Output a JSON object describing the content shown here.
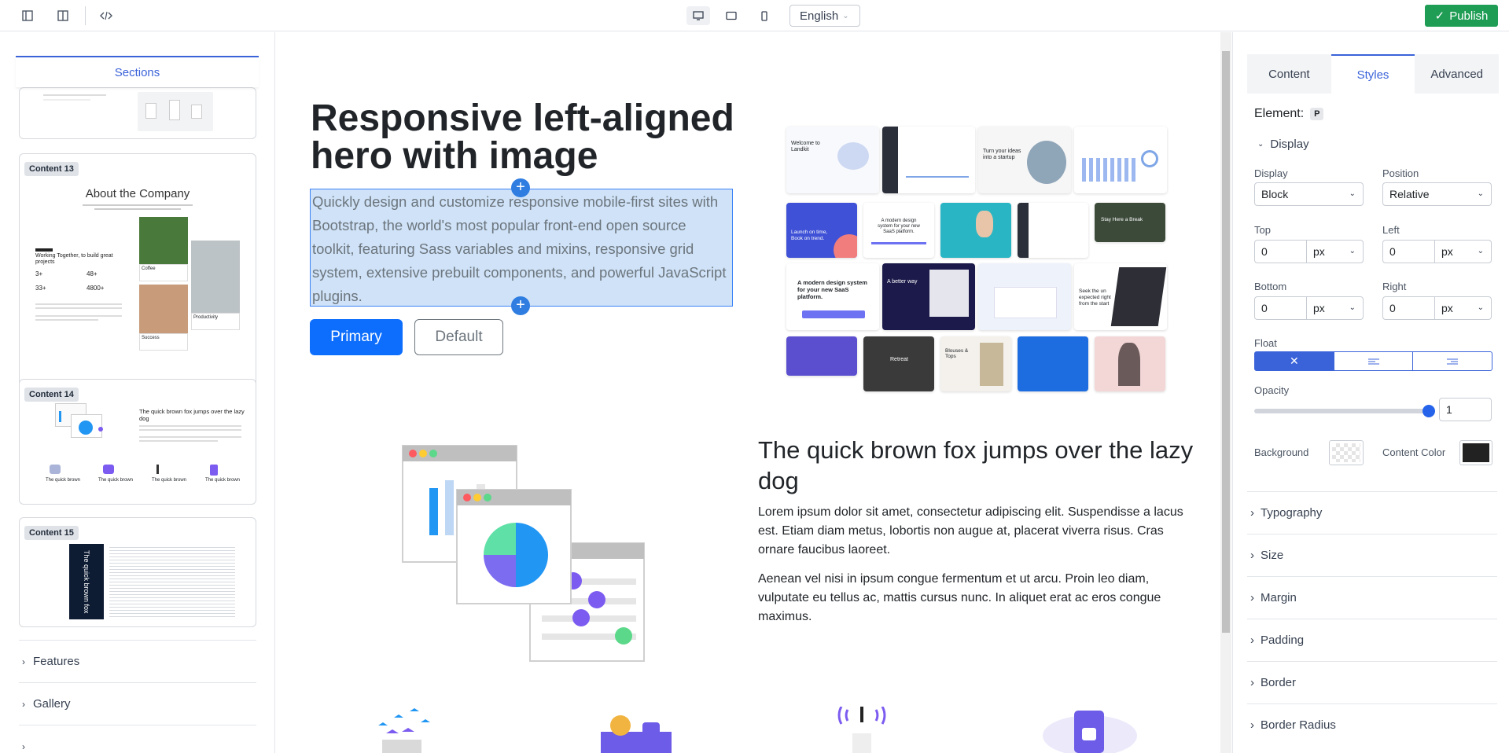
{
  "toolbar": {
    "language": "English",
    "publish": "Publish"
  },
  "left_panel": {
    "sections_tab": "Sections",
    "cards": [
      {
        "badge": "Content 13",
        "title": "About the Company",
        "subtitle": "Working Together, to build great projects",
        "stats": [
          "3+",
          "48+",
          "33+",
          "4800+"
        ],
        "captions": [
          "Coffee",
          "Productivity",
          "Success"
        ]
      },
      {
        "badge": "Content 14",
        "title": "The quick brown fox jumps over the lazy dog",
        "captions": [
          "The quick brown",
          "The quick brown",
          "The quick brown",
          "The quick brown"
        ]
      },
      {
        "badge": "Content 15",
        "vertical_text": "The quick brown fox"
      }
    ],
    "categories": [
      "Features",
      "Gallery"
    ]
  },
  "canvas": {
    "hero": {
      "title": "Responsive left-aligned hero with image",
      "lead": "Quickly design and customize responsive mobile-first sites with Bootstrap, the world's most popular front-end open source toolkit, featuring Sass variables and mixins, responsive grid system, extensive prebuilt components, and powerful JavaScript plugins.",
      "primary": "Primary",
      "default": "Default"
    },
    "collage_captions": [
      "Welcome to Landkit",
      "Turn your ideas into a startup",
      "Launch on time, Book on trend.",
      "A better way",
      "Stay Here a Break",
      "A modern design system for your new SaaS platform.",
      "Seek the un expected right from the start",
      "Blouses & Tops",
      "Retreat"
    ],
    "feature": {
      "title": "The quick brown fox jumps over the lazy dog",
      "p1": "Lorem ipsum dolor sit amet, consectetur adipiscing elit. Suspendisse a lacus est. Etiam diam metus, lobortis non augue at, placerat viverra risus. Cras ornare faucibus laoreet.",
      "p2": "Aenean vel nisi in ipsum congue fermentum et ut arcu. Proin leo diam, vulputate eu tellus ac, mattis cursus nunc. In aliquet erat ac eros congue maximus."
    }
  },
  "right_panel": {
    "tabs": [
      "Content",
      "Styles",
      "Advanced"
    ],
    "element_label": "Element:",
    "element_tag": "P",
    "display_group": "Display",
    "display_label": "Display",
    "display_value": "Block",
    "position_label": "Position",
    "position_value": "Relative",
    "top_label": "Top",
    "top_value": "0",
    "top_unit": "px",
    "left_label": "Left",
    "left_value": "0",
    "left_unit": "px",
    "bottom_label": "Bottom",
    "bottom_value": "0",
    "bottom_unit": "px",
    "right_label": "Right",
    "right_value": "0",
    "right_unit": "px",
    "float_label": "Float",
    "opacity_label": "Opacity",
    "opacity_value": "1",
    "background_label": "Background",
    "content_color_label": "Content Color",
    "content_color": "#222222",
    "accordions": [
      "Typography",
      "Size",
      "Margin",
      "Padding",
      "Border",
      "Border Radius"
    ]
  },
  "colors": {
    "accent": "#3b63d9",
    "publish": "#1f9d55",
    "primary": "#0d6efd"
  }
}
